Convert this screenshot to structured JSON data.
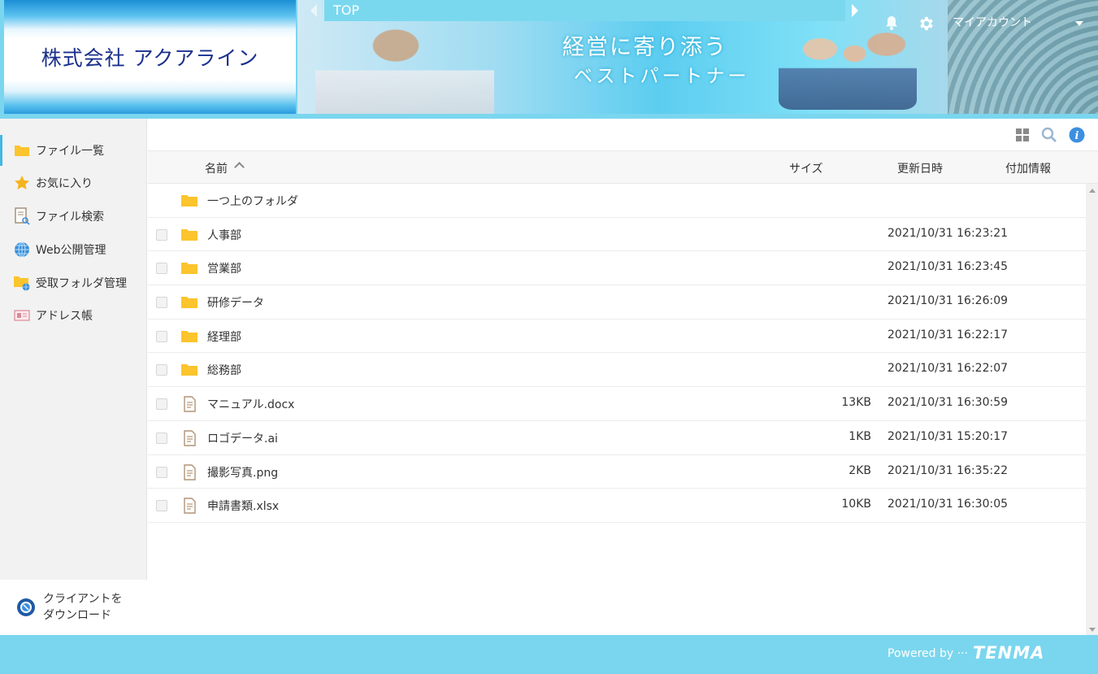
{
  "header": {
    "company_name": "株式会社 アクアライン",
    "banner_slogan_line1": "経営に寄り添う",
    "banner_slogan_line2": "ベストパートナー",
    "breadcrumb": "TOP",
    "account_label": "マイアカウント"
  },
  "sidebar": {
    "items": [
      {
        "label": "ファイル一覧",
        "icon": "folder-icon"
      },
      {
        "label": "お気に入り",
        "icon": "star-icon"
      },
      {
        "label": "ファイル検索",
        "icon": "file-search-icon"
      },
      {
        "label": "Web公開管理",
        "icon": "globe-icon"
      },
      {
        "label": "受取フォルダ管理",
        "icon": "receive-folder-icon"
      },
      {
        "label": "アドレス帳",
        "icon": "address-card-icon"
      }
    ],
    "download_label_line1": "クライアントを",
    "download_label_line2": "ダウンロード"
  },
  "table": {
    "columns": {
      "name": "名前",
      "size": "サイズ",
      "updated": "更新日時",
      "extra": "付加情報"
    },
    "parent_folder_label": "一つ上のフォルダ",
    "rows": [
      {
        "type": "folder",
        "name": "人事部",
        "size": "",
        "date": "2021/10/31 16:23:21"
      },
      {
        "type": "folder",
        "name": "営業部",
        "size": "",
        "date": "2021/10/31 16:23:45"
      },
      {
        "type": "folder",
        "name": "研修データ",
        "size": "",
        "date": "2021/10/31 16:26:09"
      },
      {
        "type": "folder",
        "name": "経理部",
        "size": "",
        "date": "2021/10/31 16:22:17"
      },
      {
        "type": "folder",
        "name": "総務部",
        "size": "",
        "date": "2021/10/31 16:22:07"
      },
      {
        "type": "file",
        "name": "マニュアル.docx",
        "size": "13KB",
        "date": "2021/10/31 16:30:59"
      },
      {
        "type": "file",
        "name": "ロゴデータ.ai",
        "size": "1KB",
        "date": "2021/10/31 15:20:17"
      },
      {
        "type": "file",
        "name": "撮影写真.png",
        "size": "2KB",
        "date": "2021/10/31 16:35:22"
      },
      {
        "type": "file",
        "name": "申請書類.xlsx",
        "size": "10KB",
        "date": "2021/10/31 16:30:05"
      }
    ]
  },
  "footer": {
    "powered_by": "Powered by ···",
    "brand": "TENMA"
  },
  "colors": {
    "accent": "#7ad6ee",
    "folder": "#fcc42d",
    "info": "#3d8fe0",
    "company_text": "#1b2f8c"
  }
}
